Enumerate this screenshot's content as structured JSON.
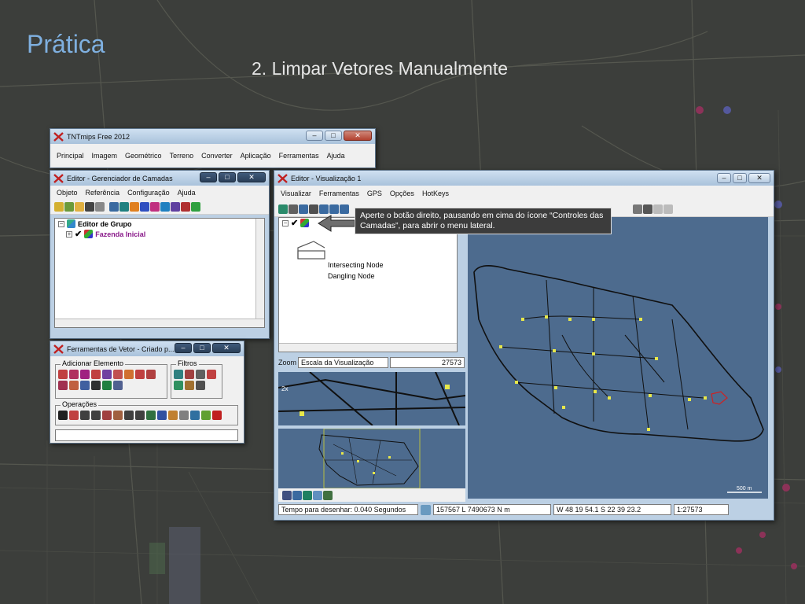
{
  "slide": {
    "title": "Prática",
    "subtitle": "2. Limpar Vetores Manualmente"
  },
  "tntmips": {
    "title": "TNTmips Free 2012",
    "menu": [
      "Principal",
      "Imagem",
      "Geométrico",
      "Terreno",
      "Converter",
      "Aplicação",
      "Ferramentas",
      "Ajuda"
    ]
  },
  "layer_manager": {
    "title": "Editor - Gerenciador de Camadas",
    "menu": [
      "Objeto",
      "Referência",
      "Configuração",
      "Ajuda"
    ],
    "tree": {
      "group": "Editor de Grupo",
      "layer": "Fazenda Inicial"
    }
  },
  "vector_tools": {
    "title": "Ferramentas de Vetor - Criado p...",
    "add_element": "Adicionar Elemento",
    "filters": "Filtros",
    "operations": "Operações"
  },
  "viewer": {
    "title": "Editor - Visualização 1",
    "menu": [
      "Visualizar",
      "Ferramentas",
      "GPS",
      "Opções",
      "HotKeys"
    ],
    "legend": [
      "Intersecting Node",
      "Dangling Node"
    ],
    "zoom_label": "Zoom",
    "zoom_mode": "Escala da Visualização",
    "zoom_value": "27573",
    "scale_bar": "500 m",
    "status": {
      "draw_time": "Tempo para desenhar: 0.040 Segundos",
      "coords_utm": "157567 L  7490673 N m",
      "coords_geo": "W 48 19 54.1  S 22 39 23.2",
      "scale": "1:27573"
    }
  },
  "callout": "Aperte o botão direito, pausando em cima do ícone “Controles das Camadas”, para abrir o menu lateral.",
  "colors": {
    "title_blue": "#7fb0e0",
    "map_blue": "#4d6b8e",
    "node_yellow": "#e8e84a",
    "node_red": "#d02020"
  }
}
